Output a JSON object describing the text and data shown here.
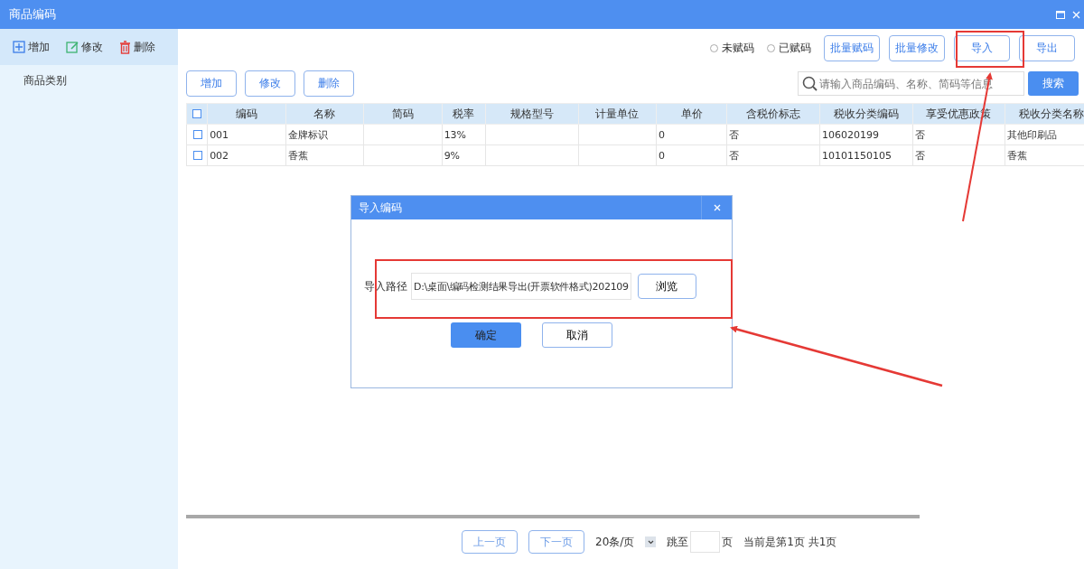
{
  "window": {
    "title": "商品编码"
  },
  "sidebar": {
    "toolbar": [
      {
        "kind": "add",
        "label": "增加"
      },
      {
        "kind": "edit",
        "label": "修改"
      },
      {
        "kind": "delete",
        "label": "删除"
      }
    ],
    "items": [
      {
        "label": "商品类别",
        "selected": false
      }
    ]
  },
  "filters": [
    {
      "label": "未赋码",
      "selected": false
    },
    {
      "label": "已赋码",
      "selected": false
    }
  ],
  "top_buttons": [
    "批量赋码",
    "批量修改",
    "导入",
    "导出"
  ],
  "row_buttons": [
    "增加",
    "修改",
    "删除"
  ],
  "search": {
    "placeholder": "请输入商品编码、名称、简码等信息",
    "button": "搜索"
  },
  "table": {
    "header_checked": false,
    "columns": [
      "编码",
      "名称",
      "简码",
      "税率",
      "规格型号",
      "计量单位",
      "单价",
      "含税价标志",
      "税收分类编码",
      "享受优惠政策",
      "税收分类名称"
    ],
    "rows": [
      {
        "checked": false,
        "cells": [
          "001",
          "金牌标识",
          "",
          "13%",
          "",
          "",
          "0",
          "否",
          "106020199",
          "否",
          "其他印刷品"
        ]
      },
      {
        "checked": false,
        "cells": [
          "002",
          "香蕉",
          "",
          "9%",
          "",
          "",
          "0",
          "否",
          "10101150105",
          "否",
          "香蕉"
        ]
      }
    ]
  },
  "pagination": {
    "prev": "上一页",
    "next": "下一页",
    "page_size": "20条/页",
    "jump_label": "跳至",
    "page_unit": "页",
    "status": "当前是第1页 共1页"
  },
  "dialog": {
    "title": "导入编码",
    "path_label": "导入路径",
    "path_value": "D:\\桌面\\编码检测结果导出(开票软件格式)202109",
    "browse": "浏览",
    "ok": "确定",
    "cancel": "取消"
  }
}
